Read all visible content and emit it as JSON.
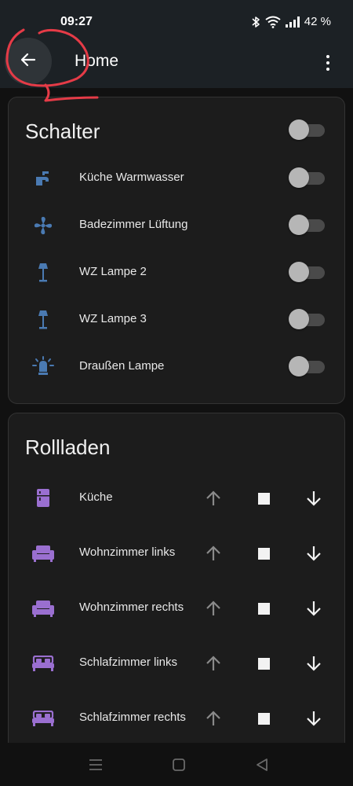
{
  "status_bar": {
    "time": "09:27",
    "battery": "42 %",
    "icons": [
      "bluetooth-icon",
      "wifi-icon",
      "signal-icon"
    ]
  },
  "app_bar": {
    "title": "Home",
    "back_icon": "arrow-left-icon",
    "menu_icon": "more-vert-icon"
  },
  "switch_card": {
    "title": "Schalter",
    "master_on": false,
    "items": [
      {
        "label": "Küche Warmwasser",
        "icon": "faucet-icon",
        "on": false
      },
      {
        "label": "Badezimmer Lüftung",
        "icon": "fan-icon",
        "on": false
      },
      {
        "label": "WZ Lampe 2",
        "icon": "floor-lamp-icon",
        "on": false
      },
      {
        "label": "WZ Lampe 3",
        "icon": "floor-lamp-icon",
        "on": false
      },
      {
        "label": "Draußen Lampe",
        "icon": "outdoor-light-icon",
        "on": false
      }
    ]
  },
  "shutter_card": {
    "title": "Rollladen",
    "items": [
      {
        "label": "Küche",
        "icon": "fridge-icon"
      },
      {
        "label": "Wohnzimmer links",
        "icon": "sofa-icon"
      },
      {
        "label": "Wohnzimmer rechts",
        "icon": "sofa-icon"
      },
      {
        "label": "Schlafzimmer links",
        "icon": "bed-icon"
      },
      {
        "label": "Schlafzimmer rechts",
        "icon": "bed-icon"
      }
    ]
  },
  "nav_bar": {
    "items": [
      "menu-icon",
      "home-icon",
      "back-triangle-icon"
    ]
  },
  "colors": {
    "switch_icon": "#4a7ab2",
    "shutter_icon": "#9a6fd0",
    "background": "#111111",
    "card": "#1c1c1c",
    "annotation": "#e53b47"
  }
}
